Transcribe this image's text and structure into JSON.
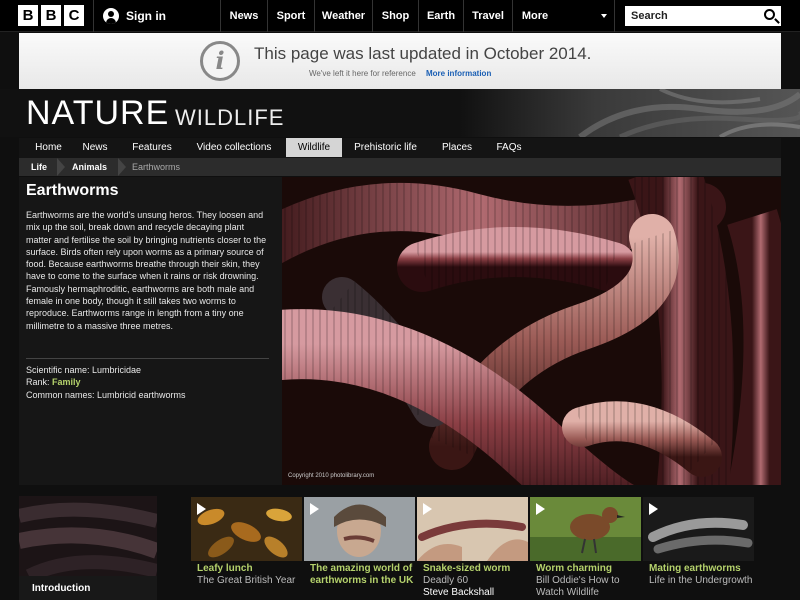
{
  "topbar": {
    "logo_letters": [
      "B",
      "B",
      "C"
    ],
    "signin_label": "Sign in",
    "nav": [
      "News",
      "Sport",
      "Weather",
      "Shop",
      "Earth",
      "Travel",
      "More"
    ],
    "search_placeholder": "Search"
  },
  "banner": {
    "icon_glyph": "i",
    "title": "This page was last updated in October 2014.",
    "subtitle": "We've left it here for reference",
    "link": "More information"
  },
  "hero": {
    "title": "NATURE",
    "subtitle": "WILDLIFE"
  },
  "section_nav": {
    "items": [
      "Home",
      "News",
      "Features",
      "Video collections",
      "Wildlife",
      "Prehistoric life",
      "Places",
      "FAQs"
    ],
    "active": "Wildlife"
  },
  "breadcrumb": [
    "Life",
    "Animals",
    "Earthworms"
  ],
  "main": {
    "title": "Earthworms",
    "description": "Earthworms are the world's unsung heros. They loosen and mix up the soil, break down and recycle decaying plant matter and fertilise the soil by bringing nutrients closer to the surface. Birds often rely upon worms as a primary source of food. Because earthworms breathe through their skin, they have to come to the surface when it rains or risk drowning. Famously hermaphroditic, earthworms are both male and female in one body, though it still takes two worms to reproduce. Earthworms range in length from a tiny one millimetre to a massive three metres.",
    "scientific_name": "Scientific name: Lumbricidae",
    "rank_label": "Rank: ",
    "rank_value": "Family",
    "common_names": "Common names: Lumbricid earthworms",
    "copyright": "Copyright 2010 photolibrary.com"
  },
  "intro_card": {
    "label": "Introduction"
  },
  "videos": [
    {
      "title": "Leafy lunch",
      "subtitle": "The Great British Year",
      "subtitle2": ""
    },
    {
      "title": "The amazing world of earthworms in the UK",
      "subtitle": "",
      "subtitle2": ""
    },
    {
      "title": "Snake-sized worm",
      "subtitle": "Deadly 60",
      "subtitle2": "Steve Backshall"
    },
    {
      "title": "Worm charming",
      "subtitle": "Bill Oddie's How to Watch Wildlife",
      "subtitle2": ""
    },
    {
      "title": "Mating earthworms",
      "subtitle": "Life in the Undergrowth",
      "subtitle2": ""
    }
  ],
  "colors": {
    "link_green": "#b5d26c",
    "banner_link": "#1a5fb4",
    "active_tab": "#d5d5d5"
  }
}
